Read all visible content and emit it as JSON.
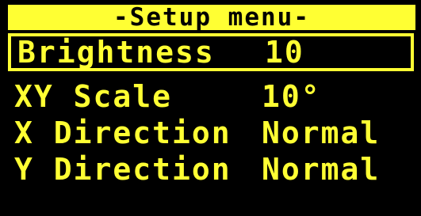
{
  "colors": {
    "foreground": "#ffff33",
    "background": "#000000"
  },
  "menu": {
    "title": "-Setup menu-",
    "items": [
      {
        "label": "Brightness",
        "value": "10",
        "selected": true
      },
      {
        "label": "XY Scale",
        "value": "10°",
        "selected": false
      },
      {
        "label": "X Direction",
        "value": "Normal",
        "selected": false
      },
      {
        "label": "Y Direction",
        "value": "Normal",
        "selected": false
      }
    ]
  }
}
